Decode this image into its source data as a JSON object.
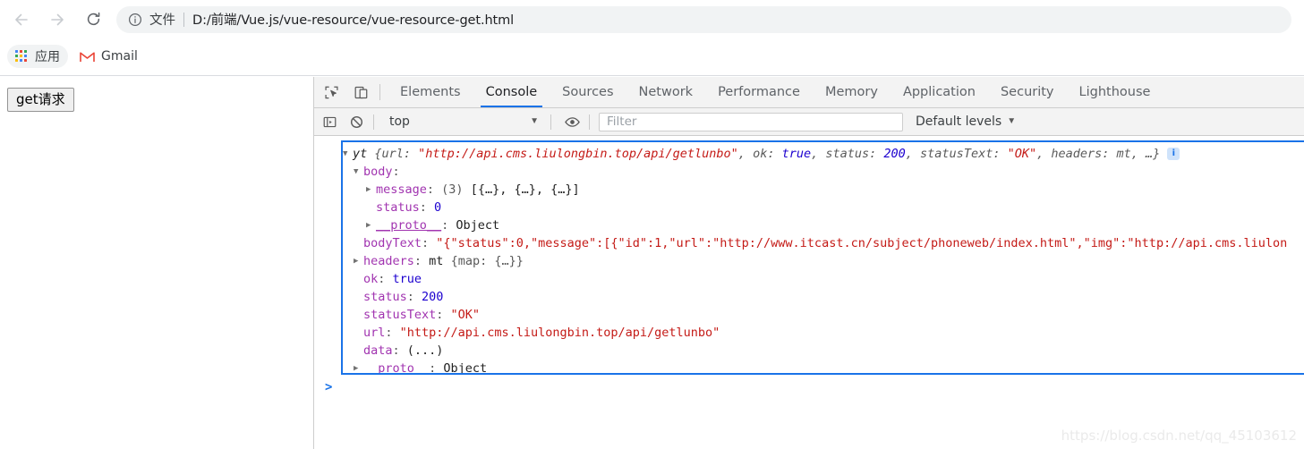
{
  "browser": {
    "nav": {
      "back_label": "Back",
      "forward_label": "Forward",
      "reload_label": "Reload"
    },
    "omnibox": {
      "scheme_label": "文件",
      "url": "D:/前端/Vue.js/vue-resource/vue-resource-get.html"
    },
    "bookmarks": [
      {
        "label": "应用",
        "icon": "apps-grid-icon"
      },
      {
        "label": "Gmail",
        "icon": "gmail-icon"
      }
    ]
  },
  "page": {
    "get_request_button": "get请求"
  },
  "devtools": {
    "tabs": [
      {
        "label": "Elements",
        "active": false
      },
      {
        "label": "Console",
        "active": true
      },
      {
        "label": "Sources",
        "active": false
      },
      {
        "label": "Network",
        "active": false
      },
      {
        "label": "Performance",
        "active": false
      },
      {
        "label": "Memory",
        "active": false
      },
      {
        "label": "Application",
        "active": false
      },
      {
        "label": "Security",
        "active": false
      },
      {
        "label": "Lighthouse",
        "active": false
      }
    ],
    "console_toolbar": {
      "context": "top",
      "filter_placeholder": "Filter",
      "filter_value": "",
      "levels": "Default levels",
      "caret": "▼"
    },
    "console_output": {
      "prompt": ">",
      "info_badge": "i",
      "lines": [
        {
          "arrow": "▼",
          "indent": 0,
          "tokens": [
            {
              "t": "yt ",
              "c": "k-name k-italic"
            },
            {
              "t": "{",
              "c": "k-dim k-italic"
            },
            {
              "t": "url: ",
              "c": "k-dim k-italic"
            },
            {
              "t": "\"http://api.cms.liulongbin.top/api/getlunbo\"",
              "c": "k-str k-italic"
            },
            {
              "t": ", ",
              "c": "k-dim k-italic"
            },
            {
              "t": "ok: ",
              "c": "k-dim k-italic"
            },
            {
              "t": "true",
              "c": "k-num k-italic"
            },
            {
              "t": ", ",
              "c": "k-dim k-italic"
            },
            {
              "t": "status: ",
              "c": "k-dim k-italic"
            },
            {
              "t": "200",
              "c": "k-num k-italic"
            },
            {
              "t": ", ",
              "c": "k-dim k-italic"
            },
            {
              "t": "statusText: ",
              "c": "k-dim k-italic"
            },
            {
              "t": "\"OK\"",
              "c": "k-str k-italic"
            },
            {
              "t": ", ",
              "c": "k-dim k-italic"
            },
            {
              "t": "headers: ",
              "c": "k-dim k-italic"
            },
            {
              "t": "mt",
              "c": "k-dim k-italic"
            },
            {
              "t": ", …}",
              "c": "k-dim k-italic"
            }
          ],
          "badge": true
        },
        {
          "arrow": "▼",
          "indent": 1,
          "tokens": [
            {
              "t": "body",
              "c": "k-prop"
            },
            {
              "t": ":",
              "c": "k-dim"
            }
          ]
        },
        {
          "arrow": "▶",
          "indent": 2,
          "tokens": [
            {
              "t": "message",
              "c": "k-prop"
            },
            {
              "t": ": ",
              "c": "k-dim"
            },
            {
              "t": "(3) ",
              "c": "k-dim"
            },
            {
              "t": "[{…}, {…}, {…}]",
              "c": "k-obj"
            }
          ]
        },
        {
          "arrow": "",
          "indent": 2,
          "tokens": [
            {
              "t": "status",
              "c": "k-prop"
            },
            {
              "t": ": ",
              "c": "k-dim"
            },
            {
              "t": "0",
              "c": "k-num"
            }
          ]
        },
        {
          "arrow": "▶",
          "indent": 2,
          "tokens": [
            {
              "t": "__proto__",
              "c": "k-proto"
            },
            {
              "t": ": ",
              "c": "k-dim"
            },
            {
              "t": "Object",
              "c": "k-obj"
            }
          ]
        },
        {
          "arrow": "",
          "indent": 1,
          "tokens": [
            {
              "t": "bodyText",
              "c": "k-prop"
            },
            {
              "t": ": ",
              "c": "k-dim"
            },
            {
              "t": "\"{\"status\":0,\"message\":[{\"id\":1,\"url\":\"http://www.itcast.cn/subject/phoneweb/index.html\",\"img\":\"http://api.cms.liulon",
              "c": "k-str"
            }
          ]
        },
        {
          "arrow": "▶",
          "indent": 1,
          "tokens": [
            {
              "t": "headers",
              "c": "k-prop"
            },
            {
              "t": ": ",
              "c": "k-dim"
            },
            {
              "t": "mt ",
              "c": "k-obj"
            },
            {
              "t": "{map: {…}}",
              "c": "k-dim"
            }
          ]
        },
        {
          "arrow": "",
          "indent": 1,
          "tokens": [
            {
              "t": "ok",
              "c": "k-prop"
            },
            {
              "t": ": ",
              "c": "k-dim"
            },
            {
              "t": "true",
              "c": "k-num"
            }
          ]
        },
        {
          "arrow": "",
          "indent": 1,
          "tokens": [
            {
              "t": "status",
              "c": "k-prop"
            },
            {
              "t": ": ",
              "c": "k-dim"
            },
            {
              "t": "200",
              "c": "k-num"
            }
          ]
        },
        {
          "arrow": "",
          "indent": 1,
          "tokens": [
            {
              "t": "statusText",
              "c": "k-prop"
            },
            {
              "t": ": ",
              "c": "k-dim"
            },
            {
              "t": "\"OK\"",
              "c": "k-str"
            }
          ]
        },
        {
          "arrow": "",
          "indent": 1,
          "tokens": [
            {
              "t": "url",
              "c": "k-prop"
            },
            {
              "t": ": ",
              "c": "k-dim"
            },
            {
              "t": "\"http://api.cms.liulongbin.top/api/getlunbo\"",
              "c": "k-str"
            }
          ]
        },
        {
          "arrow": "",
          "indent": 1,
          "tokens": [
            {
              "t": "data",
              "c": "k-prop"
            },
            {
              "t": ": ",
              "c": "k-dim"
            },
            {
              "t": "(...)",
              "c": "k-obj"
            }
          ]
        },
        {
          "arrow": "▶",
          "indent": 1,
          "tokens": [
            {
              "t": "__proto__",
              "c": "k-proto"
            },
            {
              "t": ": ",
              "c": "k-dim"
            },
            {
              "t": "Object",
              "c": "k-obj"
            }
          ]
        }
      ]
    }
  },
  "watermark": "https://blog.csdn.net/qq_45103612",
  "colors": {
    "accent": "#1a73e8",
    "string": "#c41a16",
    "number": "#1c00cf",
    "property": "#a134b0",
    "toolbar_bg": "#f3f3f3",
    "omnibox_bg": "#f1f3f4"
  }
}
